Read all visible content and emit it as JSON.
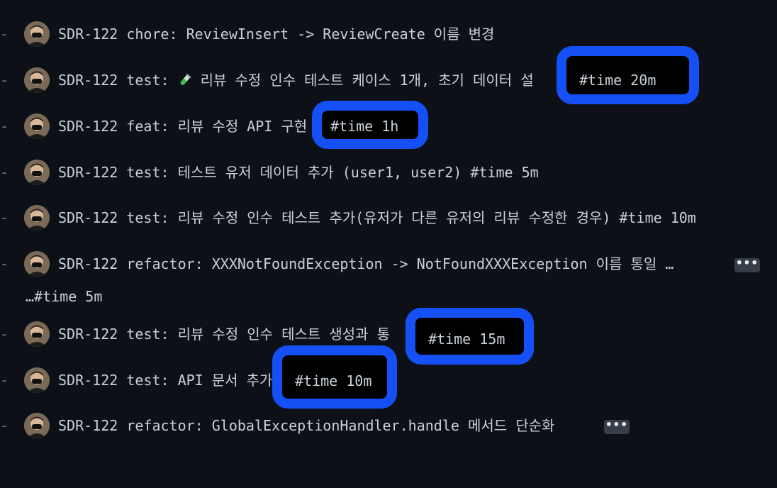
{
  "commits": [
    {
      "dash": "-",
      "message": "SDR-122 chore: ReviewInsert -> ReviewCreate 이름 변경"
    },
    {
      "dash": "-",
      "message_prefix": "SDR-122 test: ",
      "message_suffix": " 리뷰 수정 인수 테스트 케이스 1개, 초기 데이터 설",
      "emoji": "test-tube-icon"
    },
    {
      "dash": "-",
      "message": "SDR-122 feat: 리뷰 수정 API 구현"
    },
    {
      "dash": "-",
      "message": "SDR-122 test: 테스트 유저 데이터 추가 (user1, user2) #time 5m"
    },
    {
      "dash": "-",
      "message": "SDR-122 test: 리뷰 수정 인수 테스트 추가(유저가 다른 유저의 리뷰 수정한 경우) #time 10m"
    },
    {
      "dash": "-",
      "message": "SDR-122 refactor: XXXNotFoundException -> NotFoundXXXException 이름 통일 …",
      "expand_label": "•••",
      "continuation": "…#time 5m"
    },
    {
      "dash": "-",
      "message": "SDR-122 test: 리뷰 수정 인수 테스트 생성과 통"
    },
    {
      "dash": "-",
      "message": "SDR-122 test: API 문서 추가"
    },
    {
      "dash": "-",
      "message": "SDR-122 refactor: GlobalExceptionHandler.handle 메서드 단순화",
      "expand_label": "•••"
    }
  ],
  "highlights": [
    {
      "label": "#time 20m"
    },
    {
      "label": "#time 1h"
    },
    {
      "label": "#time 15m"
    },
    {
      "label": "#time 10m"
    }
  ],
  "colors": {
    "background": "#0d1117",
    "text": "#c9d1d9",
    "highlight_border": "#1450f5"
  }
}
